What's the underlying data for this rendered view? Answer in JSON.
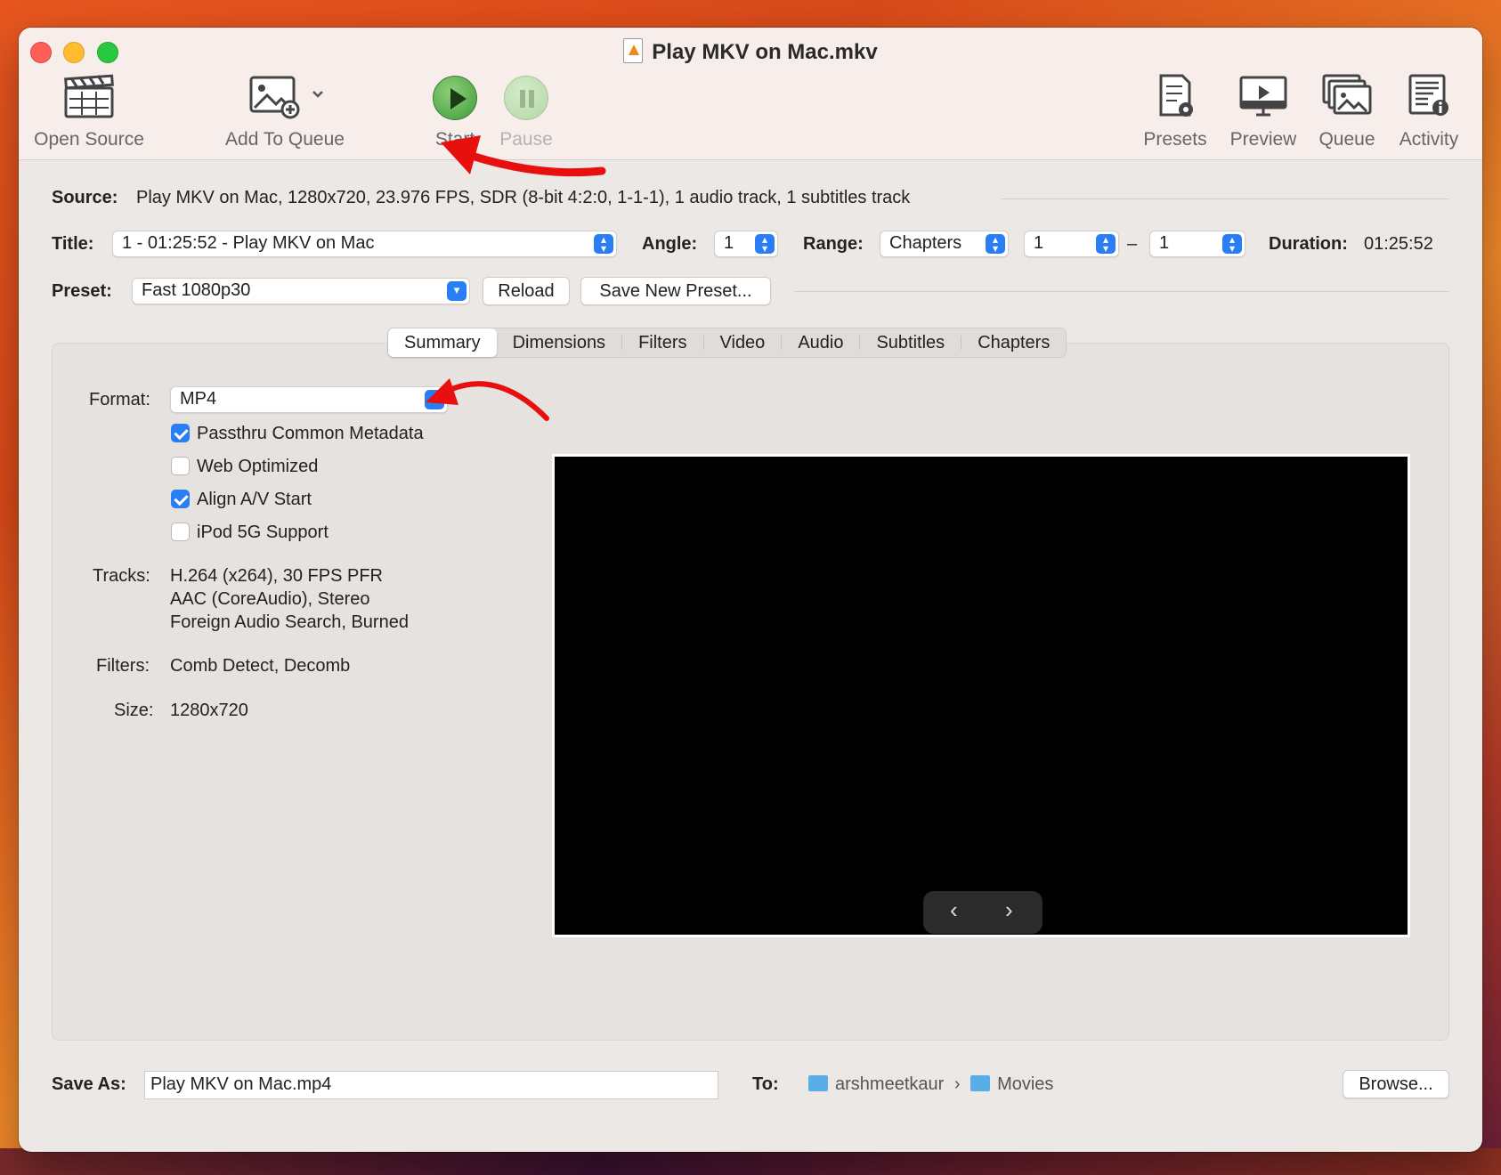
{
  "window": {
    "title": "Play MKV on Mac.mkv"
  },
  "toolbar": {
    "open_source": "Open Source",
    "add_to_queue": "Add To Queue",
    "start": "Start",
    "pause": "Pause",
    "presets": "Presets",
    "preview": "Preview",
    "queue": "Queue",
    "activity": "Activity"
  },
  "source": {
    "label": "Source:",
    "value": "Play MKV on Mac, 1280x720, 23.976 FPS, SDR (8-bit 4:2:0, 1-1-1), 1 audio track, 1 subtitles track"
  },
  "title_row": {
    "title_label": "Title:",
    "title_value": "1 - 01:25:52 - Play MKV on Mac",
    "angle_label": "Angle:",
    "angle_value": "1",
    "range_label": "Range:",
    "range_value": "Chapters",
    "range_start": "1",
    "range_dash": "–",
    "range_end": "1",
    "duration_label": "Duration:",
    "duration_value": "01:25:52"
  },
  "preset_row": {
    "label": "Preset:",
    "value": "Fast 1080p30",
    "reload": "Reload",
    "save_new": "Save New Preset..."
  },
  "tabs": [
    "Summary",
    "Dimensions",
    "Filters",
    "Video",
    "Audio",
    "Subtitles",
    "Chapters"
  ],
  "summary": {
    "format_label": "Format:",
    "format_value": "MP4",
    "checkboxes": [
      {
        "label": "Passthru Common Metadata",
        "checked": true
      },
      {
        "label": "Web Optimized",
        "checked": false
      },
      {
        "label": "Align A/V Start",
        "checked": true
      },
      {
        "label": "iPod 5G Support",
        "checked": false
      }
    ],
    "tracks_label": "Tracks:",
    "tracks": [
      "H.264 (x264), 30 FPS PFR",
      "AAC (CoreAudio), Stereo",
      "Foreign Audio Search, Burned"
    ],
    "filters_label": "Filters:",
    "filters_value": "Comb Detect, Decomb",
    "size_label": "Size:",
    "size_value": "1280x720"
  },
  "preview_nav": {
    "prev": "‹",
    "next": "›"
  },
  "save": {
    "label": "Save As:",
    "value": "Play MKV on Mac.mp4",
    "to_label": "To:",
    "path_user": "arshmeetkaur",
    "path_sep": "›",
    "path_folder": "Movies",
    "browse": "Browse..."
  },
  "colors": {
    "accent": "#2a7ef5",
    "annotation_arrow": "#e8100f"
  }
}
